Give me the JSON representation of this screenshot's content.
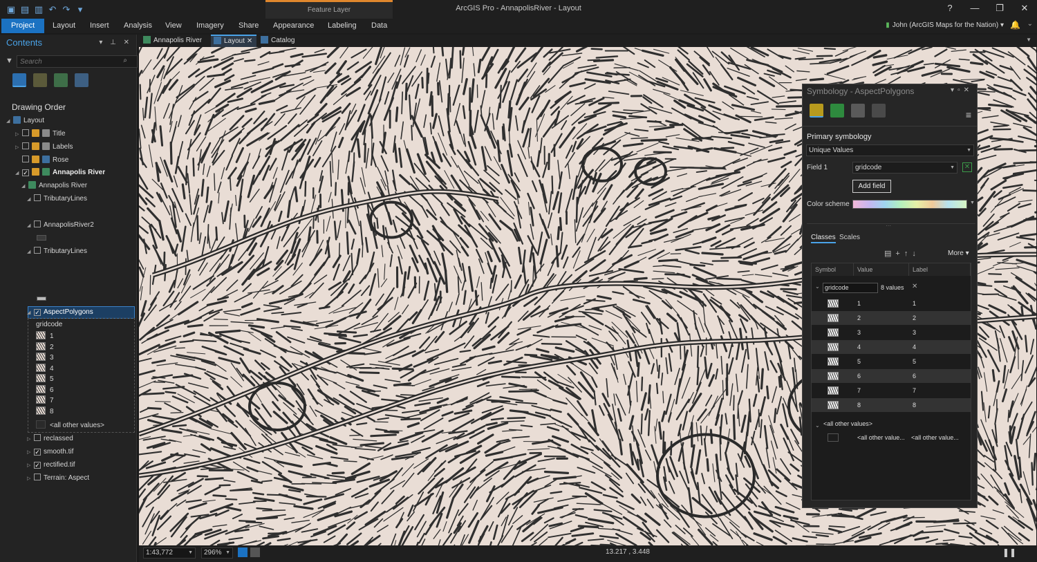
{
  "app": {
    "title": "ArcGIS Pro - AnnapolisRiver - Layout",
    "context_label": "Feature Layer",
    "window_buttons": [
      "?",
      "—",
      "❐",
      "✕"
    ]
  },
  "ribbon": {
    "tabs": [
      "Project",
      "Layout",
      "Insert",
      "Analysis",
      "View",
      "Imagery",
      "Share",
      "Appearance",
      "Labeling",
      "Data"
    ],
    "user": "John (ArcGIS Maps for the Nation)"
  },
  "contents": {
    "title": "Contents",
    "search_placeholder": "Search",
    "drawing_order": "Drawing Order",
    "layout": "Layout",
    "items": {
      "title": "Title",
      "labels": "Labels",
      "rose": "Rose",
      "annapolis_river": "Annapolis River",
      "annapolis_river_map": "Annapolis River",
      "tributary1": "TributaryLines",
      "annapolis2": "AnnapolisRiver2",
      "tributary2": "TributaryLines",
      "aspect": "AspectPolygons",
      "field": "gridcode",
      "classes": [
        "1",
        "2",
        "3",
        "4",
        "5",
        "6",
        "7",
        "8"
      ],
      "other": "<all other values>",
      "reclassed": "reclassed",
      "smooth": "smooth.tif",
      "rectified": "rectified.tif",
      "terrain": "Terrain: Aspect"
    }
  },
  "doctabs": [
    "Annapolis River",
    "Layout",
    "Catalog"
  ],
  "symbology": {
    "title": "Symbology - AspectPolygons",
    "primary": "Primary symbology",
    "method": "Unique Values",
    "field_label": "Field 1",
    "field_value": "gridcode",
    "add_field": "Add field",
    "color_scheme_label": "Color scheme",
    "tabs": [
      "Classes",
      "Scales"
    ],
    "more": "More",
    "columns": [
      "Symbol",
      "Value",
      "Label"
    ],
    "group_field": "gridcode",
    "group_count": "8 values",
    "rows": [
      {
        "value": "1",
        "label": "1"
      },
      {
        "value": "2",
        "label": "2"
      },
      {
        "value": "3",
        "label": "3"
      },
      {
        "value": "4",
        "label": "4"
      },
      {
        "value": "5",
        "label": "5"
      },
      {
        "value": "6",
        "label": "6"
      },
      {
        "value": "7",
        "label": "7"
      },
      {
        "value": "8",
        "label": "8"
      }
    ],
    "other_group": "<all other values>",
    "other_value": "<all other value...",
    "other_label": "<all other value..."
  },
  "status": {
    "scale": "1:43,772",
    "zoom": "296%",
    "coords": "13.217 , 3.448"
  },
  "colors": {
    "accent": "#1b72c2",
    "context": "#e0872d",
    "map_background": "#e9ddd5",
    "hatch": "#2f2f2f"
  }
}
